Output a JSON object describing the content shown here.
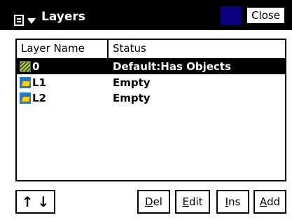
{
  "titlebar": {
    "title": "Layers",
    "close_label": "Close"
  },
  "table": {
    "columns": [
      "Layer Name",
      "Status"
    ],
    "rows": [
      {
        "name": "0",
        "status": "Default:Has Objects",
        "selected": true,
        "icon": "hatch-layer-icon"
      },
      {
        "name": "L1",
        "status": "Empty",
        "selected": false,
        "icon": "folder-layer-icon"
      },
      {
        "name": "L2",
        "status": "Empty",
        "selected": false,
        "icon": "folder-layer-icon"
      }
    ]
  },
  "buttons": {
    "up": "↑",
    "down": "↓",
    "del": {
      "hotkey": "D",
      "rest": "el"
    },
    "edit": {
      "hotkey": "E",
      "rest": "dit"
    },
    "ins": {
      "hotkey": "I",
      "rest": "ns"
    },
    "add": {
      "hotkey": "A",
      "rest": "dd"
    }
  },
  "colors": {
    "titlebar": "#000000",
    "accent_square": "#0a0080",
    "selection": "#000000"
  }
}
